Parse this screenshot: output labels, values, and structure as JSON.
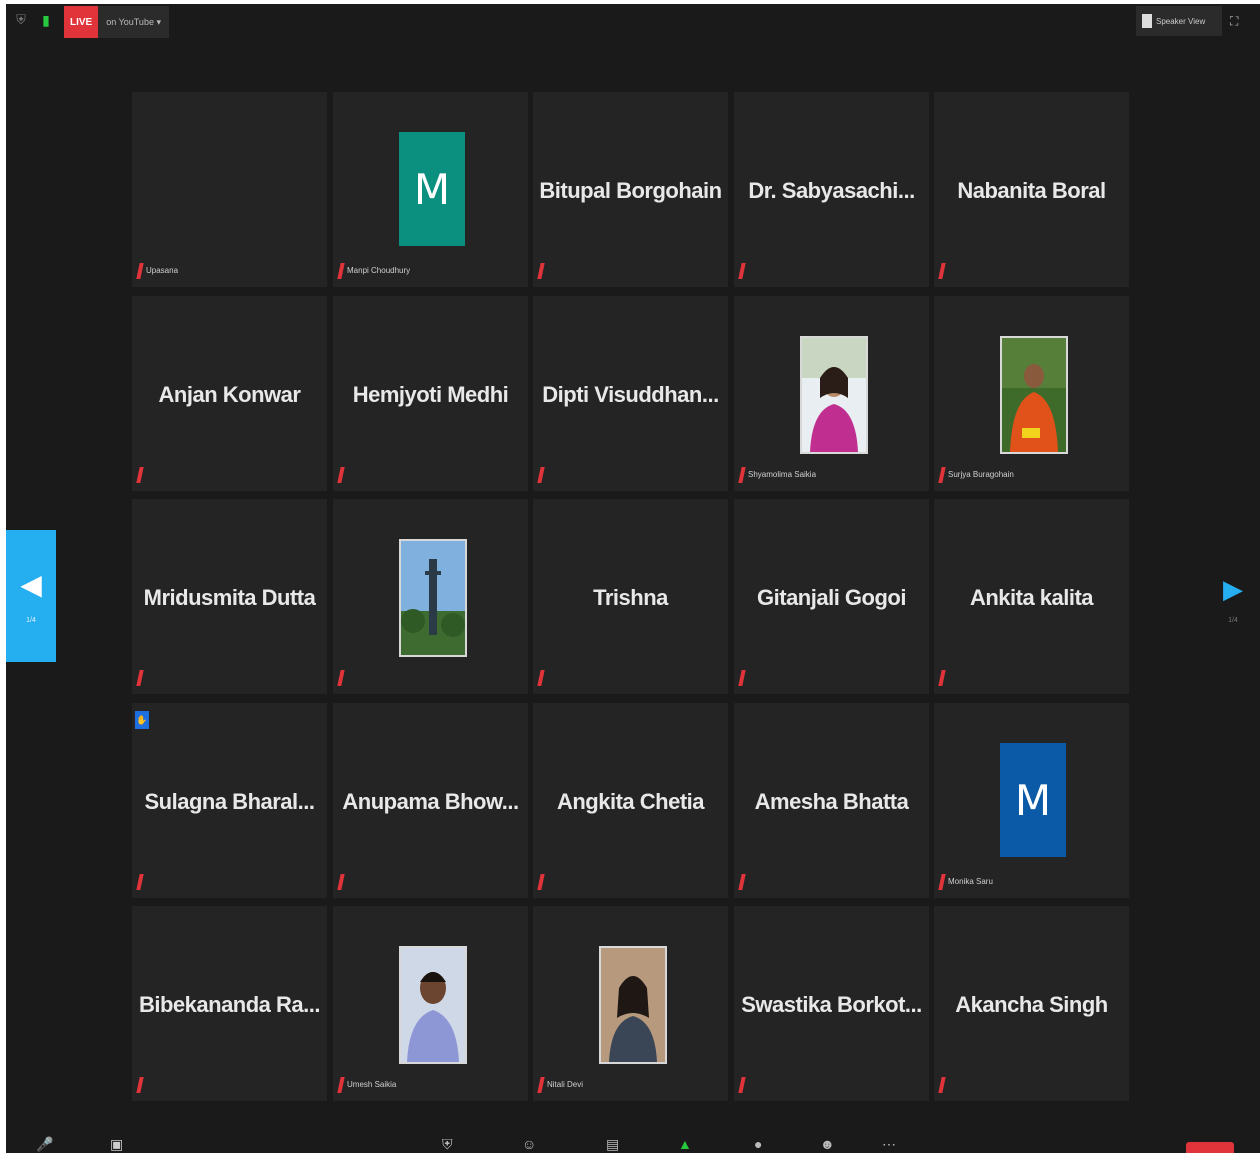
{
  "topbar": {
    "live_badge": "LIVE",
    "live_label": "on YouTube ▾",
    "view_label": "Speaker View"
  },
  "nav": {
    "prev_page": "1/4",
    "next_page": "1/4"
  },
  "colors": {
    "accent": "#25aef0",
    "mute": "#e0343a",
    "avatar_teal": "#0b8f7f",
    "avatar_blue": "#0a5aa8"
  },
  "participants": [
    {
      "center_name": "",
      "label": "Upasana",
      "type": "blank"
    },
    {
      "center_name": "",
      "label": "Manpi Choudhury",
      "type": "letter",
      "letter": "M",
      "color": "#0b8f7f"
    },
    {
      "center_name": "Bitupal Borgohain",
      "label": "",
      "type": "name"
    },
    {
      "center_name": "Dr. Sabyasachi...",
      "label": "",
      "type": "name"
    },
    {
      "center_name": "Nabanita Boral",
      "label": "",
      "type": "name"
    },
    {
      "center_name": "Anjan Konwar",
      "label": "",
      "type": "name"
    },
    {
      "center_name": "Hemjyoti Medhi",
      "label": "",
      "type": "name"
    },
    {
      "center_name": "Dipti Visuddhan...",
      "label": "",
      "type": "name"
    },
    {
      "center_name": "",
      "label": "Shyamolima Saikia",
      "type": "photo",
      "photo": "woman-pink"
    },
    {
      "center_name": "",
      "label": "Surjya Buragohain",
      "type": "photo",
      "photo": "man-orange"
    },
    {
      "center_name": "Mridusmita Dutta",
      "label": "",
      "type": "name"
    },
    {
      "center_name": "",
      "label": "",
      "type": "photo",
      "photo": "tower"
    },
    {
      "center_name": "Trishna",
      "label": "",
      "type": "name"
    },
    {
      "center_name": "Gitanjali Gogoi",
      "label": "",
      "type": "name"
    },
    {
      "center_name": "Ankita kalita",
      "label": "",
      "type": "name"
    },
    {
      "center_name": "Sulagna Bharal...",
      "label": "",
      "type": "name",
      "hand": true
    },
    {
      "center_name": "Anupama Bhow...",
      "label": "",
      "type": "name"
    },
    {
      "center_name": "Angkita Chetia",
      "label": "",
      "type": "name"
    },
    {
      "center_name": "Amesha Bhatta",
      "label": "",
      "type": "name"
    },
    {
      "center_name": "",
      "label": "Monika Saru",
      "type": "letter",
      "letter": "M",
      "color": "#0a5aa8"
    },
    {
      "center_name": "Bibekananda Ra...",
      "label": "",
      "type": "name"
    },
    {
      "center_name": "",
      "label": "Umesh Saikia",
      "type": "photo",
      "photo": "man-blue"
    },
    {
      "center_name": "",
      "label": "Nitali Devi",
      "type": "photo",
      "photo": "woman-dark"
    },
    {
      "center_name": "Swastika Borkot...",
      "label": "",
      "type": "name"
    },
    {
      "center_name": "Akancha Singh",
      "label": "",
      "type": "name"
    }
  ]
}
